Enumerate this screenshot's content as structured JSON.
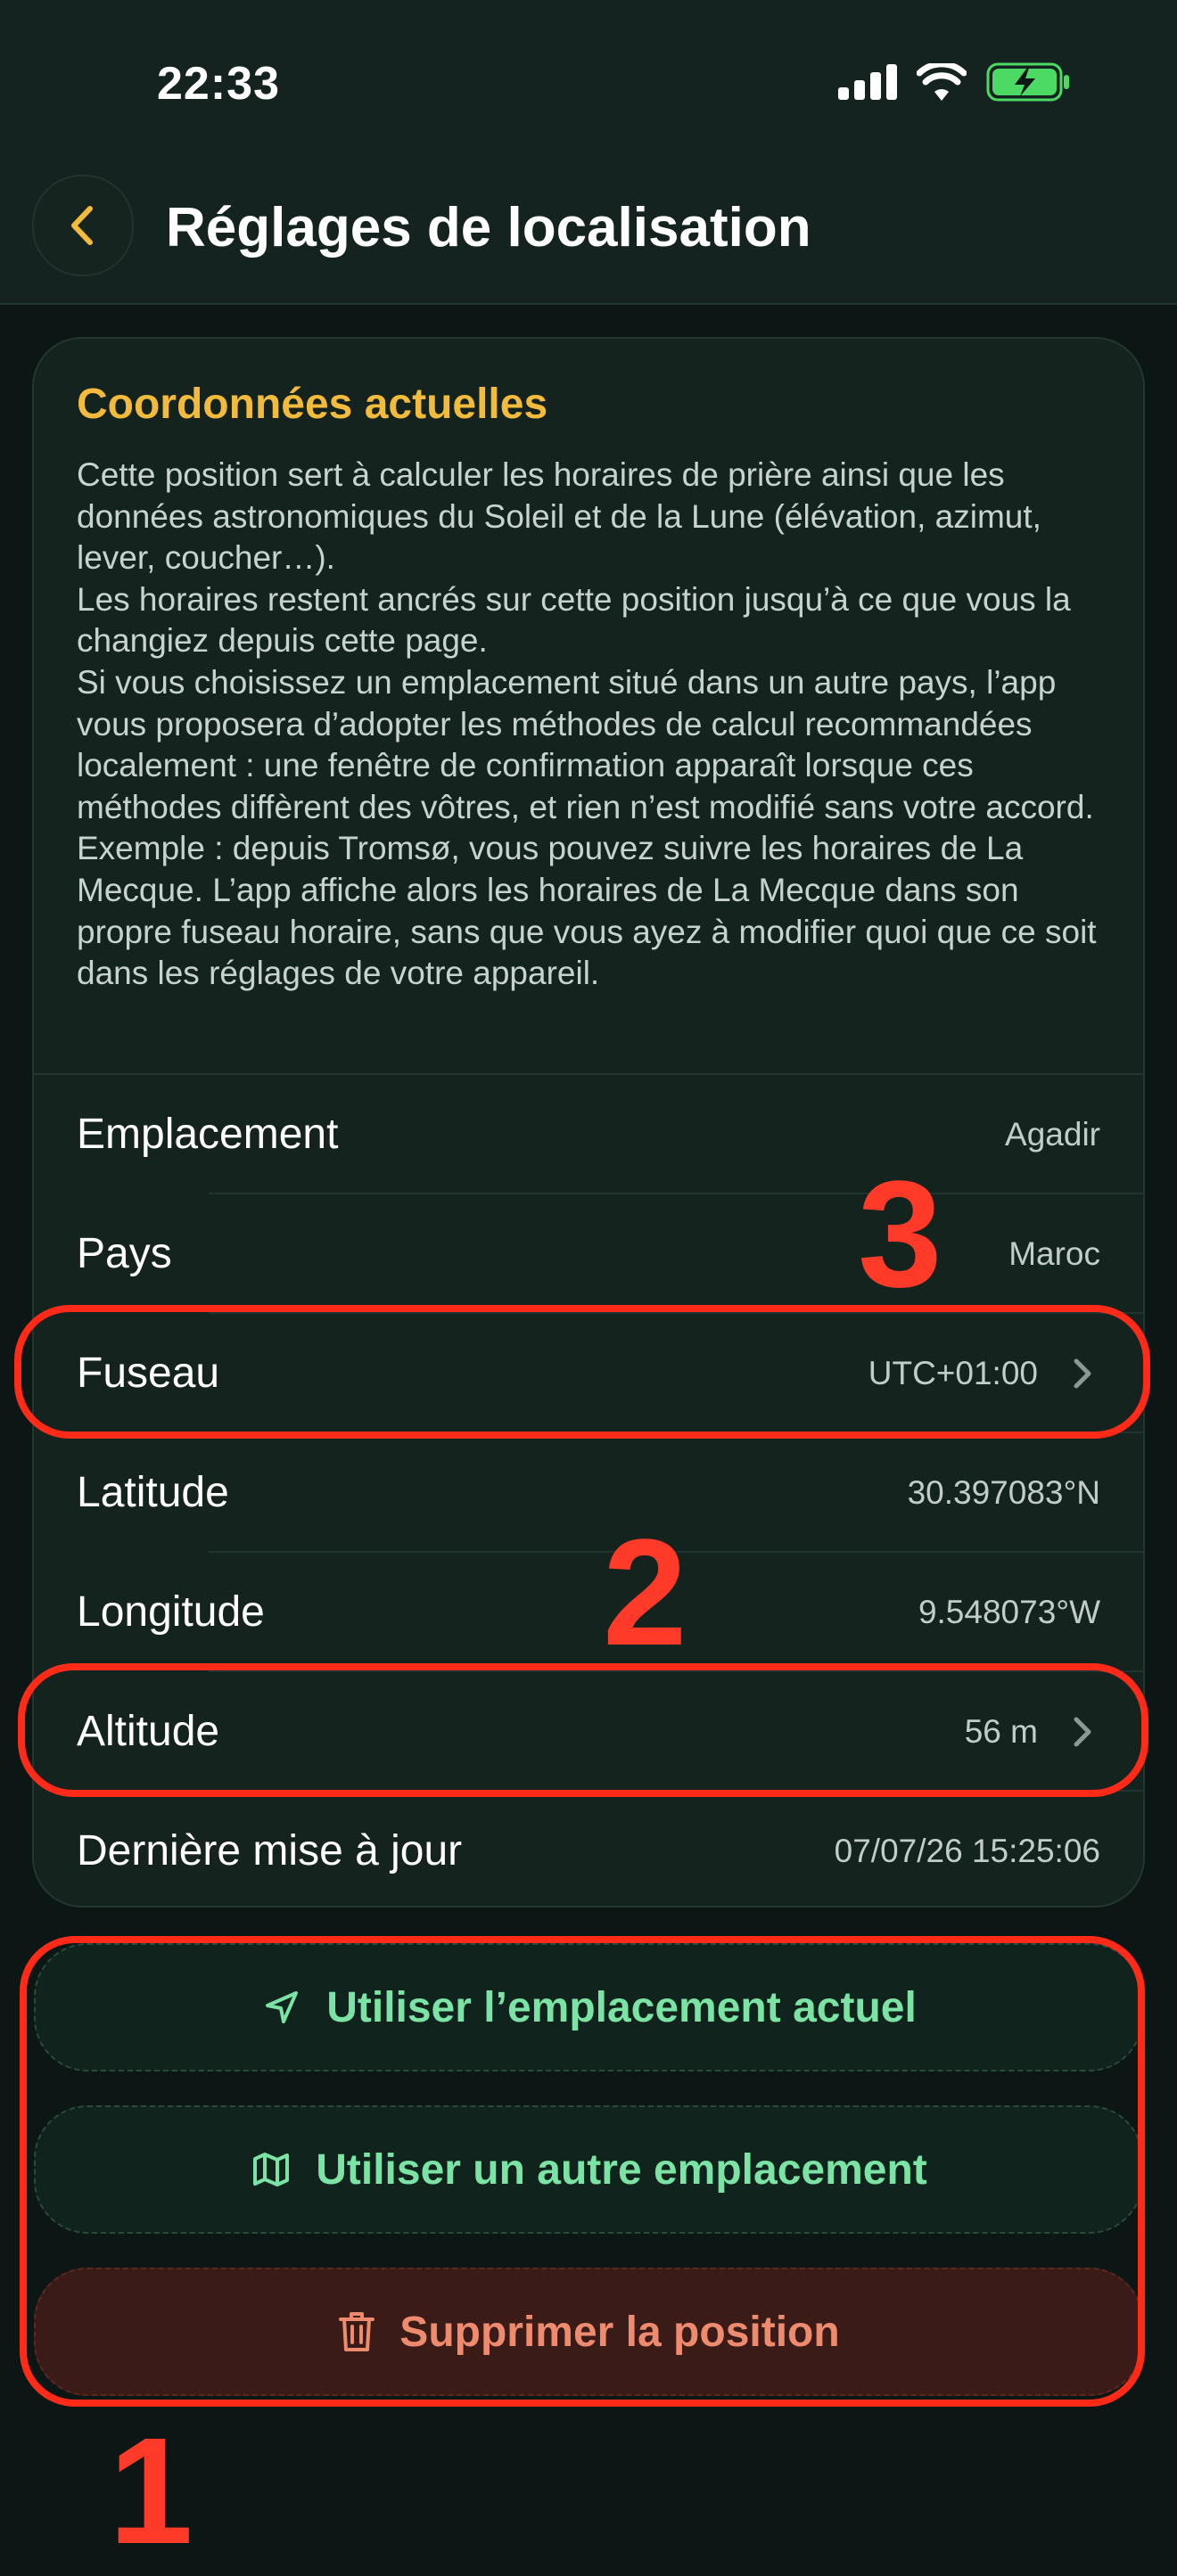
{
  "status_bar": {
    "time": "22:33"
  },
  "header": {
    "title": "Réglages de localisation"
  },
  "card": {
    "title": "Coordonnées actuelles",
    "description": "Cette position sert à calculer les horaires de prière ainsi que les données astronomiques du Soleil et de la Lune (élévation, azimut, lever, coucher…).\nLes horaires restent ancrés sur cette position jusqu’à ce que vous la changiez depuis cette page.\nSi vous choisissez un emplacement situé dans un autre pays, l’app vous proposera d’adopter les méthodes de calcul recommandées localement : une fenêtre de confirmation apparaît lorsque ces méthodes diffèrent des vôtres, et rien n’est modifié sans votre accord.\nExemple : depuis Tromsø, vous pouvez suivre les horaires de La Mecque. L’app affiche alors les horaires de La Mecque dans son propre fuseau horaire, sans que vous ayez à modifier quoi que ce soit dans les réglages de votre appareil."
  },
  "rows": [
    {
      "label": "Emplacement",
      "value": "Agadir"
    },
    {
      "label": "Pays",
      "value": "Maroc"
    },
    {
      "label": "Fuseau",
      "value": "UTC+01:00"
    },
    {
      "label": "Latitude",
      "value": "30.397083°N"
    },
    {
      "label": "Longitude",
      "value": "9.548073°W"
    },
    {
      "label": "Altitude",
      "value": "56 m"
    },
    {
      "label": "Dernière mise à jour",
      "value": "07/07/26 15:25:06"
    }
  ],
  "buttons": {
    "use_current": "Utiliser l’emplacement actuel",
    "use_other": "Utiliser un autre emplacement",
    "delete": "Supprimer la position"
  },
  "annotations": [
    "1",
    "2",
    "3"
  ],
  "colors": {
    "accent_yellow": "#f2bb3c",
    "green": "#7be3a3",
    "red_text": "#ee8b6f",
    "highlight": "#ff2a17"
  }
}
